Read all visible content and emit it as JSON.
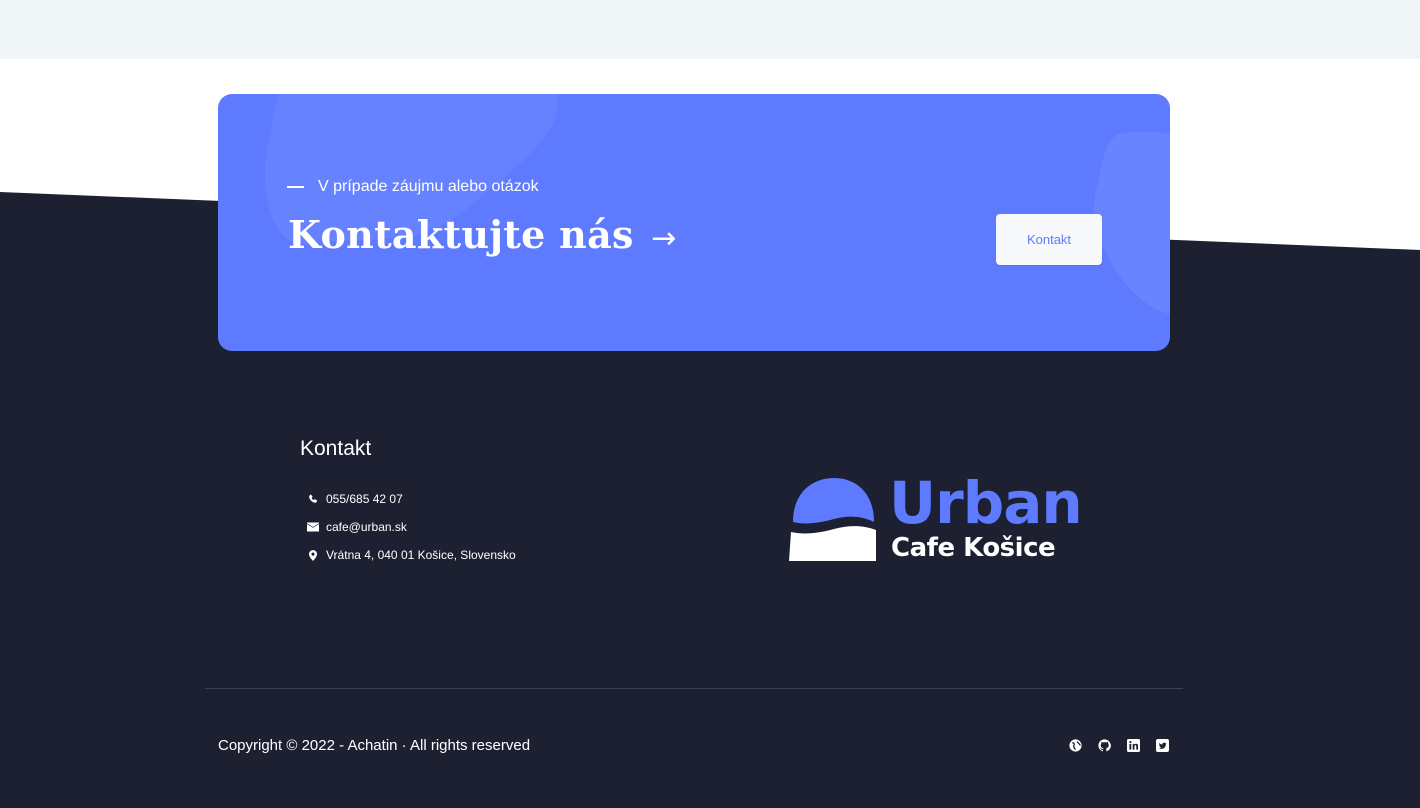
{
  "colors": {
    "accent": "#5e7bff",
    "dark": "#1d2030",
    "top_band": "#f0f5f8"
  },
  "cta": {
    "eyebrow": "V prípade záujmu alebo otázok",
    "title": "Kontaktujte nás",
    "title_arrow": "→",
    "button_label": "Kontakt"
  },
  "contact": {
    "heading": "Kontakt",
    "items": [
      {
        "icon": "phone-icon",
        "text": "055/685 42 07"
      },
      {
        "icon": "envelope-icon",
        "text": "cafe@urban.sk"
      },
      {
        "icon": "map-pin-icon",
        "text": "Vrátna 4, 040 01 Košice, Slovensko"
      }
    ]
  },
  "logo": {
    "name": "Urban",
    "subtitle": "Cafe Košice"
  },
  "footer": {
    "copyright": "Copyright © 2022 - Achatin · All rights reserved",
    "socials": [
      "globe-icon",
      "github-icon",
      "linkedin-icon",
      "twitter-icon"
    ]
  }
}
